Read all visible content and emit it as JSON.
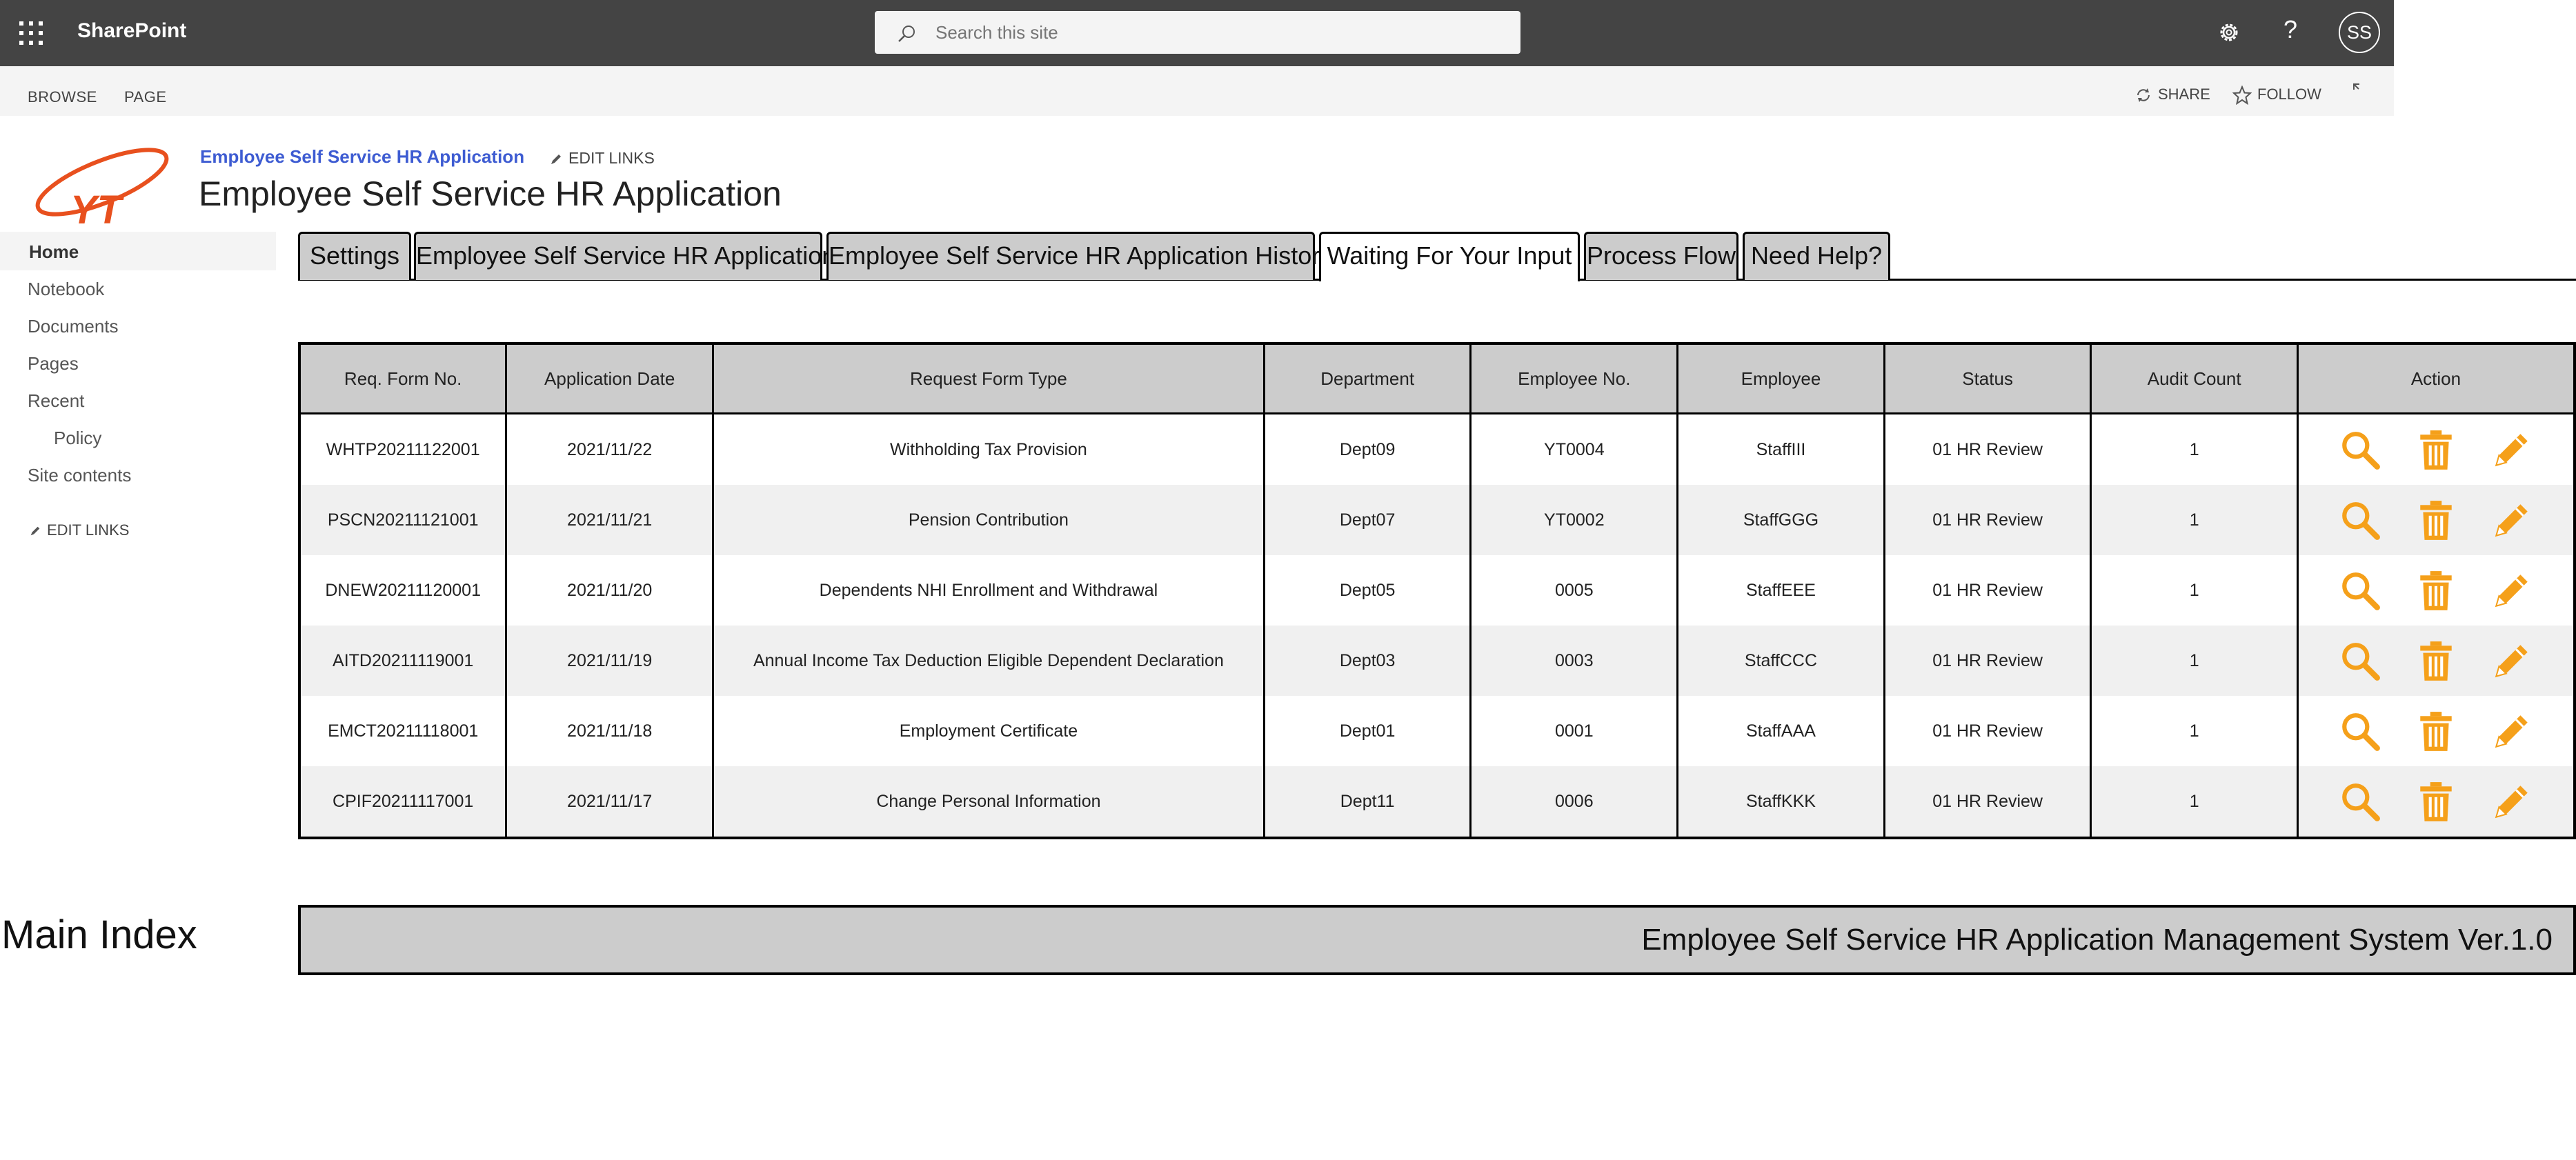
{
  "suite": {
    "brand": "SharePoint",
    "search_placeholder": "Search this site",
    "help": "?",
    "avatar_initials": "SS"
  },
  "ribbon": {
    "browse": "BROWSE",
    "page": "PAGE",
    "share": "SHARE",
    "follow": "FOLLOW"
  },
  "site": {
    "breadcrumb": "Employee Self Service HR Application",
    "edit_links": "EDIT LINKS",
    "title": "Employee Self Service HR Application"
  },
  "leftnav": {
    "items": [
      "Home",
      "Notebook",
      "Documents",
      "Pages",
      "Recent",
      "Policy",
      "Site contents"
    ],
    "edit_links": "EDIT LINKS"
  },
  "tabs": [
    {
      "label": "Settings",
      "active": false
    },
    {
      "label": "Employee Self Service HR Application",
      "active": false
    },
    {
      "label": "Employee Self Service HR Application History",
      "active": false
    },
    {
      "label": "Waiting For Your Input",
      "active": true
    },
    {
      "label": "Process Flow",
      "active": false
    },
    {
      "label": "Need Help?",
      "active": false
    }
  ],
  "table": {
    "headers": [
      "Req. Form No.",
      "Application Date",
      "Request Form Type",
      "Department",
      "Employee No.",
      "Employee",
      "Status",
      "Audit Count",
      "Action"
    ],
    "rows": [
      [
        "WHTP20211122001",
        "2021/11/22",
        "Withholding Tax Provision",
        "Dept09",
        "YT0004",
        "StaffIII",
        "01 HR Review",
        "1"
      ],
      [
        "PSCN20211121001",
        "2021/11/21",
        "Pension Contribution",
        "Dept07",
        "YT0002",
        "StaffGGG",
        "01 HR Review",
        "1"
      ],
      [
        "DNEW20211120001",
        "2021/11/20",
        "Dependents NHI Enrollment and Withdrawal",
        "Dept05",
        "0005",
        "StaffEEE",
        "01 HR Review",
        "1"
      ],
      [
        "AITD20211119001",
        "2021/11/19",
        "Annual Income Tax Deduction Eligible Dependent Declaration",
        "Dept03",
        "0003",
        "StaffCCC",
        "01 HR Review",
        "1"
      ],
      [
        "EMCT20211118001",
        "2021/11/18",
        "Employment Certificate",
        "Dept01",
        "0001",
        "StaffAAA",
        "01 HR Review",
        "1"
      ],
      [
        "CPIF20211117001",
        "2021/11/17",
        "Change Personal Information",
        "Dept11",
        "0006",
        "StaffKKK",
        "01 HR Review",
        "1"
      ]
    ],
    "action_icons": [
      "search-icon",
      "trash-icon",
      "pencil-icon"
    ]
  },
  "footer": {
    "main_index": "Main Index",
    "system_name": "Employee Self Service HR Application Management System Ver.1.0"
  },
  "colors": {
    "suitebar": "#444444",
    "link": "#3e5cd2",
    "action_icon": "#f5a01a",
    "header_fill": "#cccccc"
  }
}
